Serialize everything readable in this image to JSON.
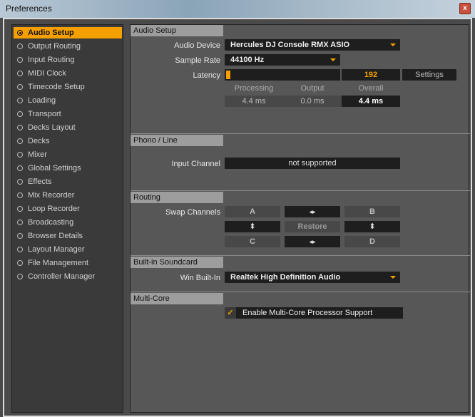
{
  "window": {
    "title": "Preferences",
    "close": "x"
  },
  "sidebar": {
    "items": [
      {
        "label": "Audio Setup",
        "active": true
      },
      {
        "label": "Output Routing"
      },
      {
        "label": "Input Routing"
      },
      {
        "label": "MIDI Clock"
      },
      {
        "label": "Timecode Setup"
      },
      {
        "label": "Loading"
      },
      {
        "label": "Transport"
      },
      {
        "label": "Decks Layout"
      },
      {
        "label": "Decks"
      },
      {
        "label": "Mixer"
      },
      {
        "label": "Global Settings"
      },
      {
        "label": "Effects"
      },
      {
        "label": "Mix Recorder"
      },
      {
        "label": "Loop Recorder"
      },
      {
        "label": "Broadcasting"
      },
      {
        "label": "Browser Details"
      },
      {
        "label": "Layout Manager"
      },
      {
        "label": "File Management"
      },
      {
        "label": "Controller Manager"
      }
    ]
  },
  "audio_setup": {
    "header": "Audio Setup",
    "device_label": "Audio Device",
    "device": "Hercules DJ Console RMX ASIO",
    "rate_label": "Sample Rate",
    "rate": "44100 Hz",
    "latency_label": "Latency",
    "latency_value": "192",
    "latency_fraction": 0.02,
    "settings": "Settings",
    "processing_label": "Processing",
    "output_label": "Output",
    "overall_label": "Overall",
    "processing": "4.4 ms",
    "output": "0.0 ms",
    "overall": "4.4 ms"
  },
  "phono": {
    "header": "Phono / Line",
    "input_label": "Input Channel",
    "input_value": "not supported"
  },
  "routing": {
    "header": "Routing",
    "swap_label": "Swap Channels",
    "a": "A",
    "b": "B",
    "c": "C",
    "d": "D",
    "lr": "◂▸",
    "ud": "⬍",
    "restore": "Restore"
  },
  "soundcard": {
    "header": "Built-in Soundcard",
    "label": "Win Built-In",
    "value": "Realtek High Definition Audio"
  },
  "multicore": {
    "header": "Multi-Core",
    "checkbox": "Enable Multi-Core Processor Support",
    "checked": true
  },
  "colors": {
    "accent": "#f5a000"
  }
}
